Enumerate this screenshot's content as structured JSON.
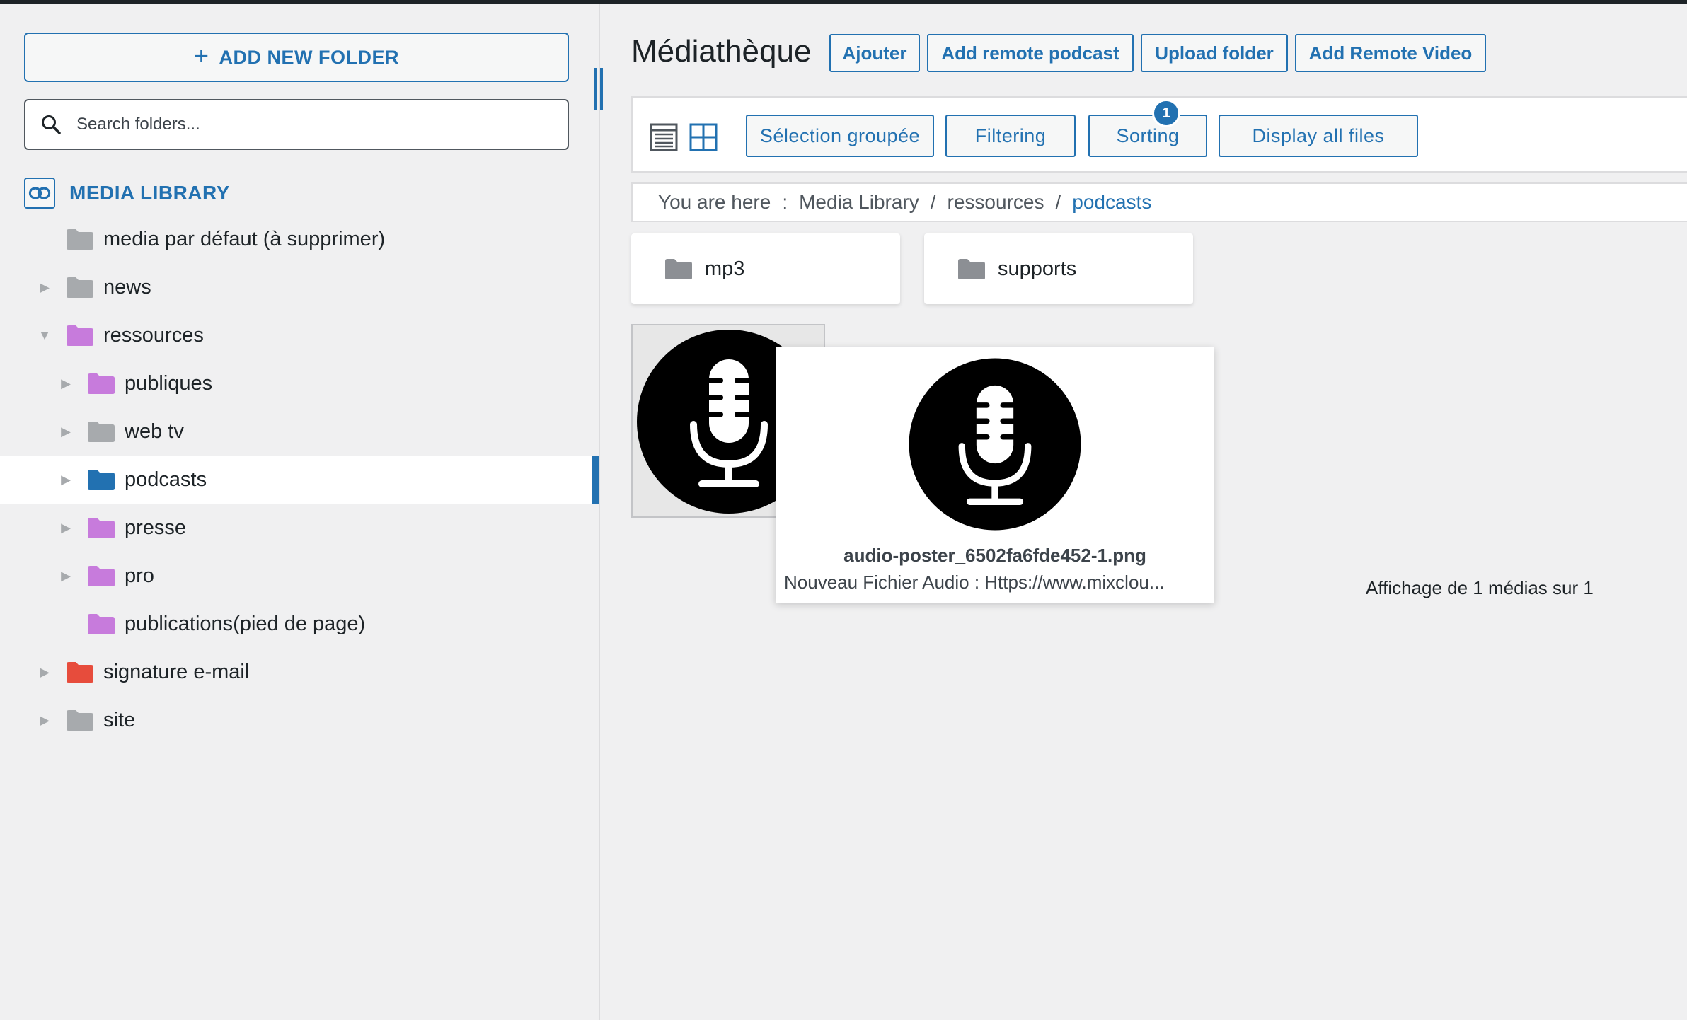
{
  "sidebar": {
    "add_folder_label": "ADD NEW FOLDER",
    "search_placeholder": "Search folders...",
    "library_title": "MEDIA LIBRARY",
    "folders": [
      {
        "label": "media par défaut (à supprimer)",
        "color": "#a7aaad",
        "level": 1,
        "toggle": "none"
      },
      {
        "label": "news",
        "color": "#a7aaad",
        "level": 1,
        "toggle": "collapsed"
      },
      {
        "label": "ressources",
        "color": "#c77bdc",
        "level": 1,
        "toggle": "expanded"
      },
      {
        "label": "publiques",
        "color": "#c77bdc",
        "level": 2,
        "toggle": "collapsed"
      },
      {
        "label": "web tv",
        "color": "#a7aaad",
        "level": 2,
        "toggle": "collapsed"
      },
      {
        "label": "podcasts",
        "color": "#2271b1",
        "level": 2,
        "toggle": "collapsed",
        "selected": true
      },
      {
        "label": "presse",
        "color": "#c77bdc",
        "level": 2,
        "toggle": "collapsed"
      },
      {
        "label": "pro",
        "color": "#c77bdc",
        "level": 2,
        "toggle": "collapsed"
      },
      {
        "label": "publications(pied de page)",
        "color": "#c77bdc",
        "level": 2,
        "toggle": "none"
      },
      {
        "label": "signature e-mail",
        "color": "#e74c3c",
        "level": 1,
        "toggle": "collapsed"
      },
      {
        "label": "site",
        "color": "#a7aaad",
        "level": 1,
        "toggle": "collapsed"
      }
    ]
  },
  "header": {
    "title": "Médiathèque",
    "buttons": {
      "ajouter": "Ajouter",
      "add_remote_podcast": "Add remote podcast",
      "upload_folder": "Upload folder",
      "add_remote_video": "Add Remote Video"
    }
  },
  "toolbar": {
    "bulk_select": "Sélection groupée",
    "filtering": "Filtering",
    "sorting": "Sorting",
    "sorting_badge": "1",
    "display_all": "Display all files"
  },
  "breadcrumb": {
    "prefix": "You are here",
    "separator": ":",
    "items": [
      "Media Library",
      "ressources",
      "podcasts"
    ]
  },
  "subfolders": [
    "mp3",
    "supports"
  ],
  "media": {
    "filename": "audio-poster_6502fa6fde452-1.png",
    "description": "Nouveau Fichier Audio : Https://www.mixclou..."
  },
  "count_text": "Affichage de 1 médias sur 1",
  "colors": {
    "accent": "#2271b1",
    "gray_folder": "#a7aaad",
    "purple_folder": "#c77bdc",
    "red_folder": "#e74c3c"
  }
}
